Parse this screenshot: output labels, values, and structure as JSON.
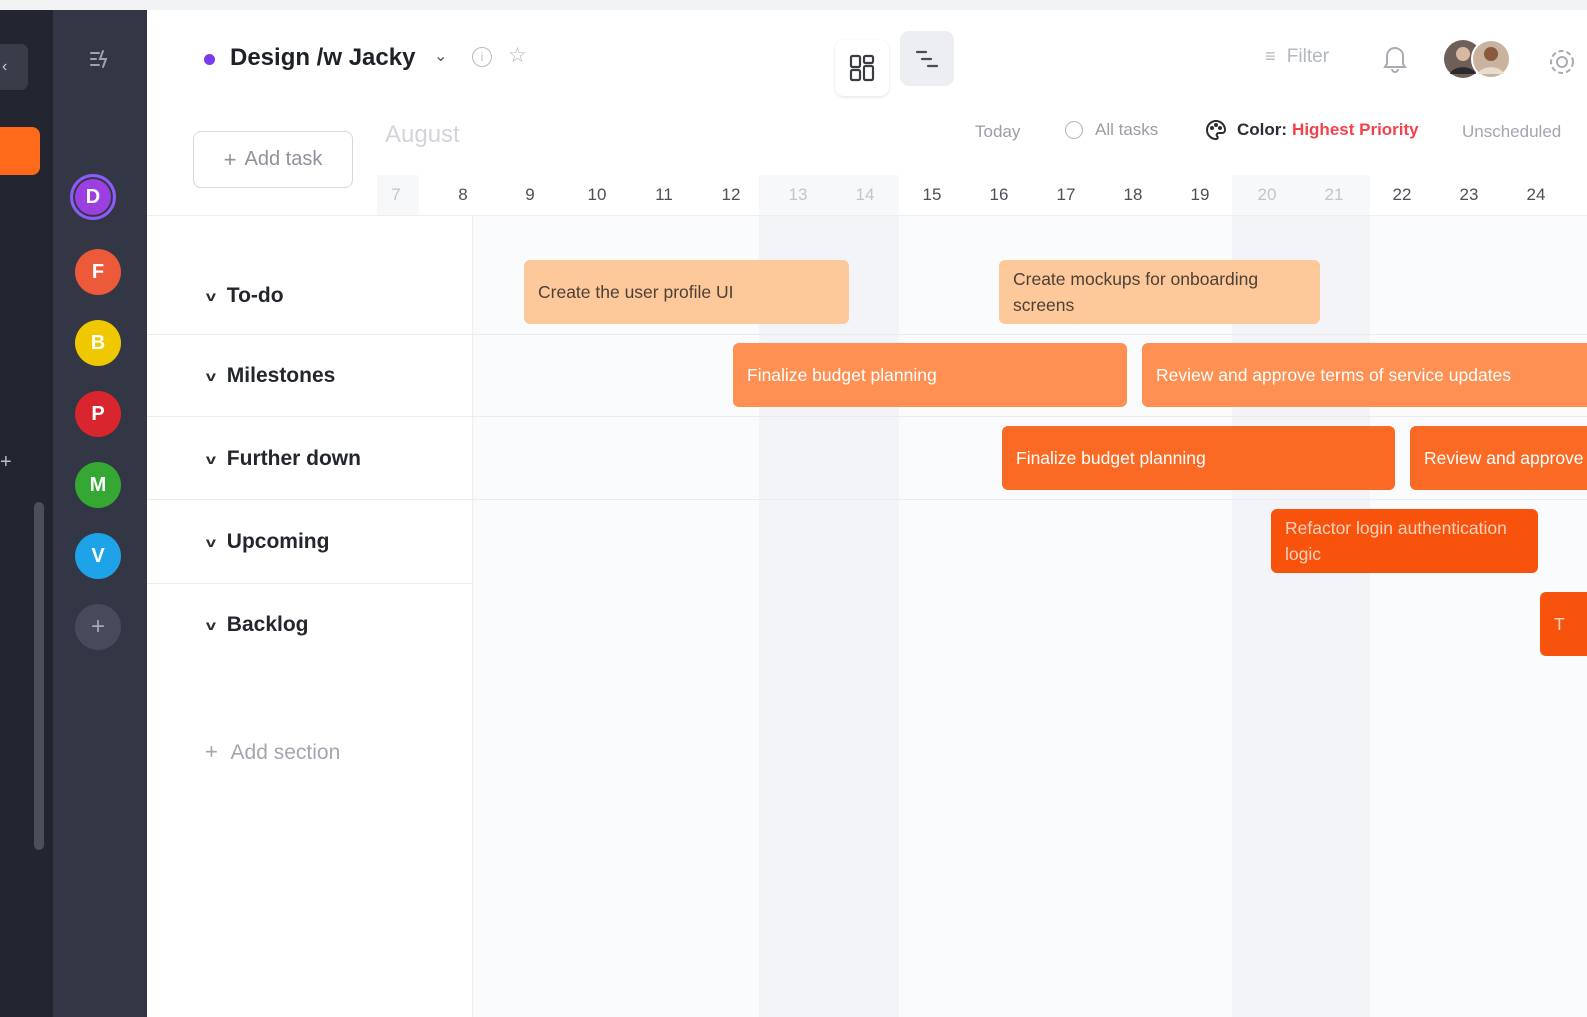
{
  "project": {
    "title": "Design /w Jacky",
    "dot_color": "#7c3aed"
  },
  "toolbar": {
    "filter_label": "Filter"
  },
  "add_task_label": "Add task",
  "timeline": {
    "month": "August",
    "today_label": "Today",
    "all_tasks_label": "All tasks",
    "color_label": "Color:",
    "color_value": "Highest Priority",
    "unscheduled_label": "Unscheduled",
    "days": [
      "7",
      "8",
      "9",
      "10",
      "11",
      "12",
      "13",
      "14",
      "15",
      "16",
      "17",
      "18",
      "19",
      "20",
      "21",
      "22",
      "23",
      "24"
    ]
  },
  "workspaces": [
    {
      "letter": "D",
      "color": "#9b3fe0"
    },
    {
      "letter": "F",
      "color": "#ec5a3a"
    },
    {
      "letter": "B",
      "color": "#f0c800"
    },
    {
      "letter": "P",
      "color": "#d9262e"
    },
    {
      "letter": "M",
      "color": "#35a833"
    },
    {
      "letter": "V",
      "color": "#1ea3e8"
    }
  ],
  "sections": [
    "To-do",
    "Milestones",
    "Further down",
    "Upcoming",
    "Backlog"
  ],
  "add_section_label": "Add section",
  "tasks": [
    {
      "label": "Create the user profile UI"
    },
    {
      "label": "Create mockups for onboarding screens"
    },
    {
      "label": "Finalize budget planning"
    },
    {
      "label": "Review and approve terms of service updates"
    },
    {
      "label": "Finalize budget planning"
    },
    {
      "label": "Review and approve"
    },
    {
      "label": "Refactor login authentication logic"
    },
    {
      "label": "T"
    }
  ],
  "colors": {
    "accent": "#ff6a1a",
    "priority_text": "#f2434b"
  }
}
